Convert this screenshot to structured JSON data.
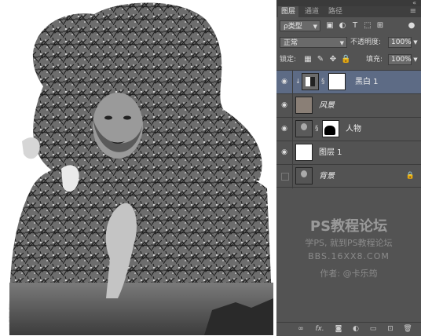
{
  "panel": {
    "collapse_icon": "double-chevron",
    "tabs": [
      {
        "label": "图层",
        "active": true
      },
      {
        "label": "通道",
        "active": false
      },
      {
        "label": "路径",
        "active": false
      }
    ],
    "filter_label": "ρ类型",
    "blend_mode": "正常",
    "opacity_label": "不透明度:",
    "opacity_value": "100%",
    "lock_label": "锁定:",
    "fill_label": "填充:",
    "fill_value": "100%",
    "layers": [
      {
        "name": "黑白 1",
        "selected": true,
        "visible": true
      },
      {
        "name": "风景",
        "selected": false,
        "visible": true
      },
      {
        "name": "人物",
        "selected": false,
        "visible": true
      },
      {
        "name": "图层 1",
        "selected": false,
        "visible": true
      },
      {
        "name": "背景",
        "selected": false,
        "visible": false,
        "locked": true
      }
    ]
  },
  "watermark": {
    "title": "PS教程论坛",
    "line2": "学PS, 就到PS教程论坛",
    "line3": "BBS.16XX8.COM",
    "author": "作者: @卡乐筠"
  },
  "colors": {
    "panel_bg": "#535353",
    "selected_layer": "#5d6b85",
    "canvas_bg": "#ffffff"
  }
}
